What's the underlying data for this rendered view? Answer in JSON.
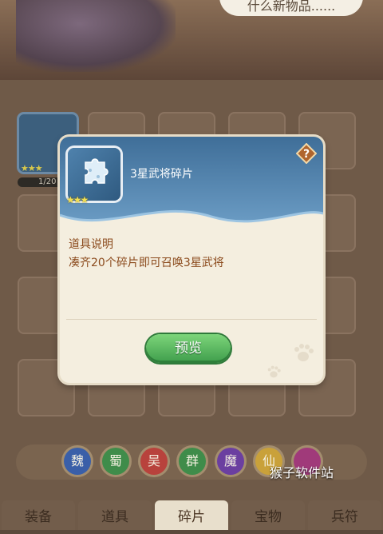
{
  "background": {
    "speech_text": "什么新物品......",
    "owned_card": {
      "progress": "1/20"
    },
    "watermark": "猴子软件站"
  },
  "factions": [
    {
      "label": "魏",
      "color": "#3a5fa8"
    },
    {
      "label": "蜀",
      "color": "#3f8c4a"
    },
    {
      "label": "吴",
      "color": "#b8423c"
    },
    {
      "label": "群",
      "color": "#3f8c4a"
    },
    {
      "label": "魔",
      "color": "#6b3fa0"
    },
    {
      "label": "仙",
      "color": "#c9a13a"
    },
    {
      "label": "",
      "color": "#a03a7a"
    }
  ],
  "tabs": [
    {
      "label": "装备",
      "active": false
    },
    {
      "label": "道具",
      "active": false
    },
    {
      "label": "碎片",
      "active": true
    },
    {
      "label": "宝物",
      "active": false
    },
    {
      "label": "兵符",
      "active": false
    }
  ],
  "dialog": {
    "item_name": "3星武将碎片",
    "star_count": 3,
    "help_icon": "question-mark-icon",
    "description_title": "道具说明",
    "description_text": "凑齐20个碎片即可召唤3星武将",
    "preview_button": "预览"
  }
}
